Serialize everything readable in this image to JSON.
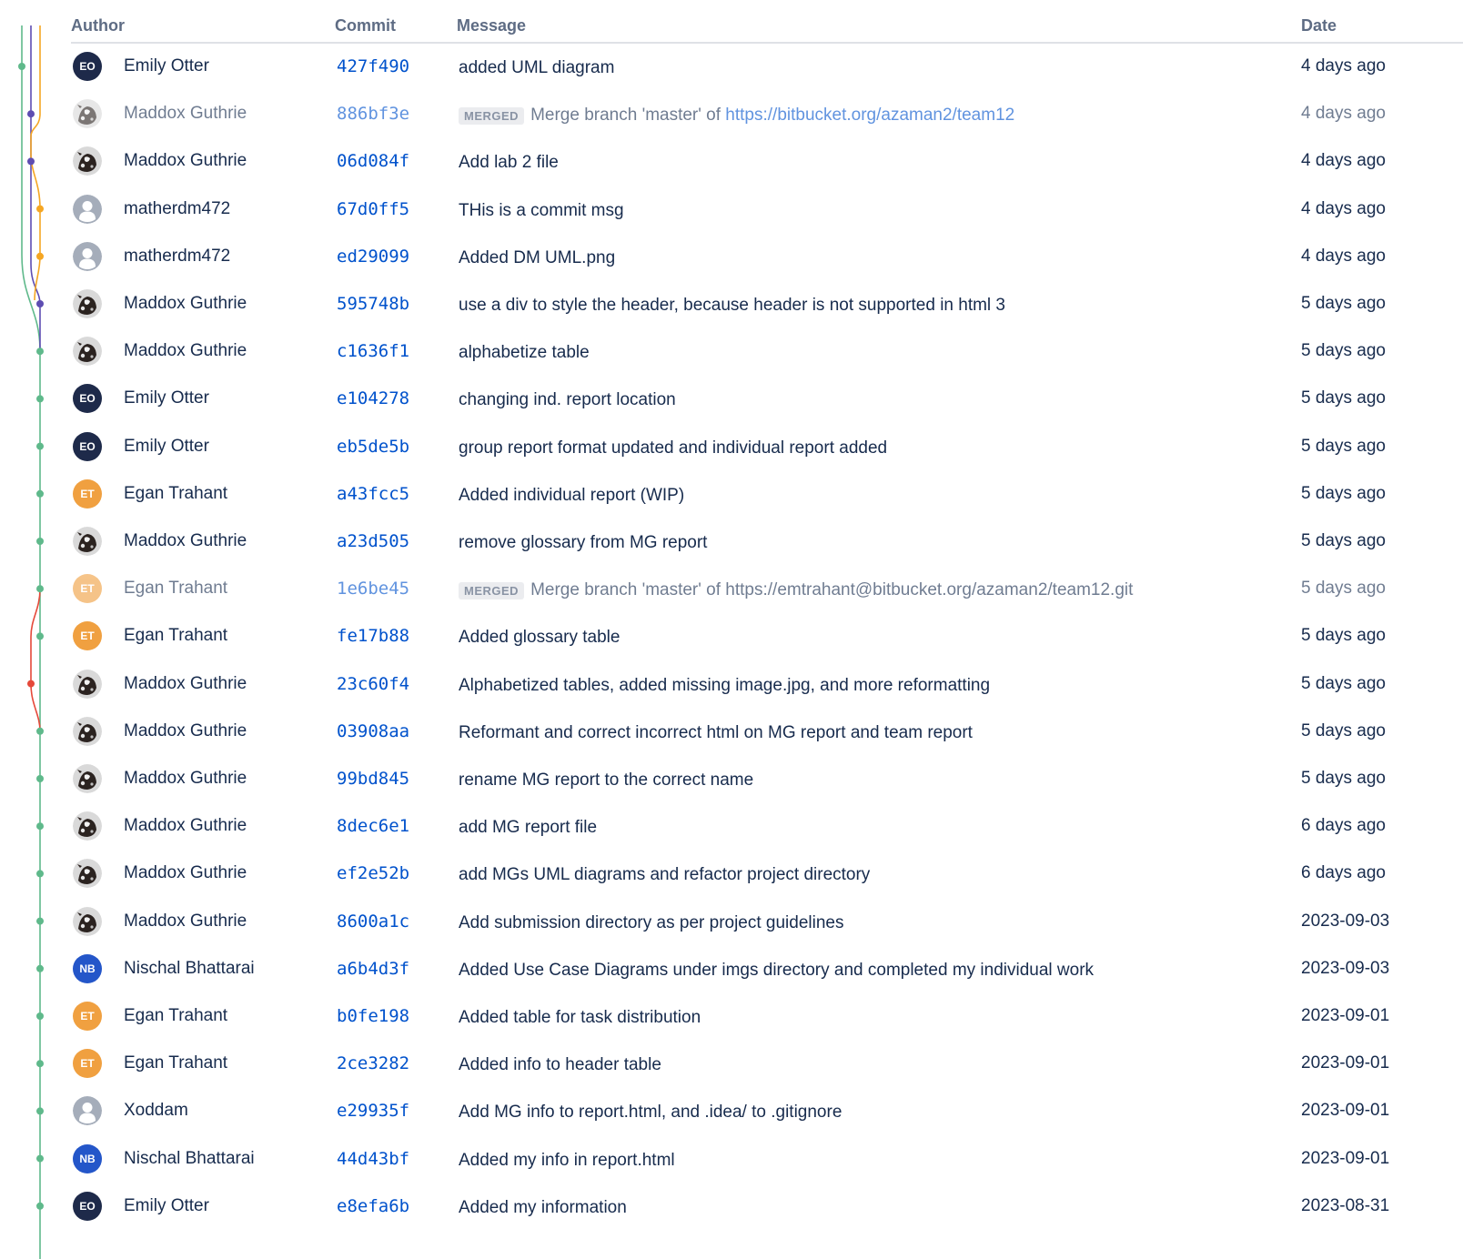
{
  "header": {
    "author": "Author",
    "commit": "Commit",
    "message": "Message",
    "date": "Date"
  },
  "colors": {
    "link": "#0052cc",
    "graph_green": "#5fb98b",
    "graph_purple": "#5e4db2",
    "graph_orange": "#f5a623",
    "graph_red": "#e5493a",
    "avatar_eo": "#1e2a4a",
    "avatar_et": "#f0a040",
    "avatar_nb": "#2456c9"
  },
  "commits": [
    {
      "author": "Emily Otter",
      "avatar": "EO",
      "hash": "427f490",
      "merged": false,
      "message": "added UML diagram",
      "date": "4 days ago"
    },
    {
      "author": "Maddox Guthrie",
      "avatar": "cow",
      "hash": "886bf3e",
      "merged": true,
      "badge": "MERGED",
      "message": "Merge branch 'master' of ",
      "link": "https://bitbucket.org/azaman2/team12",
      "date": "4 days ago"
    },
    {
      "author": "Maddox Guthrie",
      "avatar": "cow",
      "hash": "06d084f",
      "merged": false,
      "message": "Add lab 2 file",
      "date": "4 days ago"
    },
    {
      "author": "matherdm472",
      "avatar": "default",
      "hash": "67d0ff5",
      "merged": false,
      "message": "THis is a commit msg",
      "date": "4 days ago"
    },
    {
      "author": "matherdm472",
      "avatar": "default",
      "hash": "ed29099",
      "merged": false,
      "message": "Added DM UML.png",
      "date": "4 days ago"
    },
    {
      "author": "Maddox Guthrie",
      "avatar": "cow",
      "hash": "595748b",
      "merged": false,
      "message": "use a div to style the header, because header is not supported in html 3",
      "date": "5 days ago"
    },
    {
      "author": "Maddox Guthrie",
      "avatar": "cow",
      "hash": "c1636f1",
      "merged": false,
      "message": "alphabetize table",
      "date": "5 days ago"
    },
    {
      "author": "Emily Otter",
      "avatar": "EO",
      "hash": "e104278",
      "merged": false,
      "message": "changing ind. report location",
      "date": "5 days ago"
    },
    {
      "author": "Emily Otter",
      "avatar": "EO",
      "hash": "eb5de5b",
      "merged": false,
      "message": "group report format updated and individual report added",
      "date": "5 days ago"
    },
    {
      "author": "Egan Trahant",
      "avatar": "ET",
      "hash": "a43fcc5",
      "merged": false,
      "message": "Added individual report (WIP)",
      "date": "5 days ago"
    },
    {
      "author": "Maddox Guthrie",
      "avatar": "cow",
      "hash": "a23d505",
      "merged": false,
      "message": "remove glossary from MG report",
      "date": "5 days ago"
    },
    {
      "author": "Egan Trahant",
      "avatar": "ET",
      "hash": "1e6be45",
      "merged": true,
      "badge": "MERGED",
      "message": "Merge branch 'master' of https://emtrahant@bitbucket.org/azaman2/team12.git",
      "date": "5 days ago"
    },
    {
      "author": "Egan Trahant",
      "avatar": "ET",
      "hash": "fe17b88",
      "merged": false,
      "message": "Added glossary table",
      "date": "5 days ago"
    },
    {
      "author": "Maddox Guthrie",
      "avatar": "cow",
      "hash": "23c60f4",
      "merged": false,
      "message": "Alphabetized tables, added missing image.jpg, and more reformatting",
      "date": "5 days ago"
    },
    {
      "author": "Maddox Guthrie",
      "avatar": "cow",
      "hash": "03908aa",
      "merged": false,
      "message": "Reformant and correct incorrect html on MG report and team report",
      "date": "5 days ago"
    },
    {
      "author": "Maddox Guthrie",
      "avatar": "cow",
      "hash": "99bd845",
      "merged": false,
      "message": "rename MG report to the correct name",
      "date": "5 days ago"
    },
    {
      "author": "Maddox Guthrie",
      "avatar": "cow",
      "hash": "8dec6e1",
      "merged": false,
      "message": "add MG report file",
      "date": "6 days ago"
    },
    {
      "author": "Maddox Guthrie",
      "avatar": "cow",
      "hash": "ef2e52b",
      "merged": false,
      "message": "add MGs UML diagrams and refactor project directory",
      "date": "6 days ago"
    },
    {
      "author": "Maddox Guthrie",
      "avatar": "cow",
      "hash": "8600a1c",
      "merged": false,
      "message": "Add submission directory as per project guidelines",
      "date": "2023-09-03"
    },
    {
      "author": "Nischal Bhattarai",
      "avatar": "NB",
      "hash": "a6b4d3f",
      "merged": false,
      "message": "Added Use Case Diagrams under imgs directory and completed my individual work",
      "date": "2023-09-03"
    },
    {
      "author": "Egan Trahant",
      "avatar": "ET",
      "hash": "b0fe198",
      "merged": false,
      "message": "Added table for task distribution",
      "date": "2023-09-01"
    },
    {
      "author": "Egan Trahant",
      "avatar": "ET",
      "hash": "2ce3282",
      "merged": false,
      "message": "Added info to header table",
      "date": "2023-09-01"
    },
    {
      "author": "Xoddam",
      "avatar": "default",
      "hash": "e29935f",
      "merged": false,
      "message": "Add MG info to report.html, and .idea/ to .gitignore",
      "date": "2023-09-01"
    },
    {
      "author": "Nischal Bhattarai",
      "avatar": "NB",
      "hash": "44d43bf",
      "merged": false,
      "message": "Added my info in report.html",
      "date": "2023-09-01"
    },
    {
      "author": "Emily Otter",
      "avatar": "EO",
      "hash": "e8efa6b",
      "merged": false,
      "message": "Added my information",
      "date": "2023-08-31"
    }
  ]
}
